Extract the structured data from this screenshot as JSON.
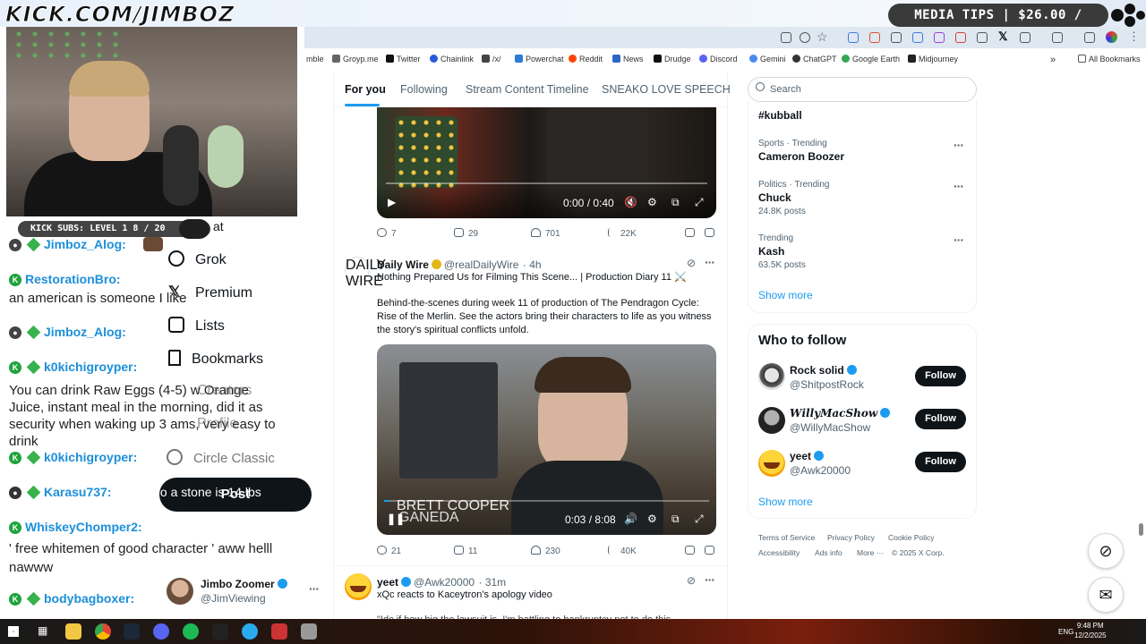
{
  "overlay": {
    "stream_url": "KICK.COM/JIMBOZ",
    "media_tips": "MEDIA TIPS | $26.00 / $200.00",
    "kick_subs": "KICK SUBS: LEVEL 1 8 / 20"
  },
  "chat": [
    {
      "user": "Jimboz_Alog:",
      "text": ""
    },
    {
      "user": "RestorationBro:",
      "text": "an american is someone I like"
    },
    {
      "user": "Jimboz_Alog:",
      "text": ""
    },
    {
      "user": "k0kichigroyper:",
      "text": "You can drink Raw Eggs (4-5) w Orange Juice, instant meal in the morning, did it as security when waking up 3 ams, very easy to drink"
    },
    {
      "user": "k0kichigroyper:",
      "text": ""
    },
    {
      "user": "Karasu737:",
      "text": "ahh, no a stone is 14 lbs"
    },
    {
      "user": "WhiskeyChomper2:",
      "text": "' free whitemen of good character ' aww helll nawww"
    },
    {
      "user": "bodybagboxer:",
      "text": ""
    }
  ],
  "bookmarks": [
    "mble",
    "Groyp.me",
    "Twitter",
    "Chainlink",
    "/x/",
    "Powerchat",
    "Reddit",
    "News",
    "Drudge",
    "Discord",
    "Gemini",
    "ChatGPT",
    "Google Earth",
    "Midjourney"
  ],
  "all_bookmarks": "All Bookmarks",
  "nav": {
    "chat_partial": "at",
    "grok": "Grok",
    "premium": "Premium",
    "lists": "Lists",
    "bookmarks": "Bookmarks",
    "more_partial": "Creators",
    "profile_partial": "Profile",
    "circle_classic": "Circle Classic",
    "post_button": "Post",
    "account_name": "Jimbo Zoomer",
    "account_handle": "@JimViewing"
  },
  "tabs": [
    "For you",
    "Following",
    "Stream Content Timeline",
    "SNEAKO LOVE SPEECH"
  ],
  "tweet1": {
    "video_time": "0:00 / 0:40",
    "replies": "7",
    "reposts": "29",
    "likes": "701",
    "views": "22K"
  },
  "tweet2": {
    "name": "Daily Wire",
    "handle": "@realDailyWire",
    "time": "· 4h",
    "avatar_text": "DAILY WIRE",
    "headline": "Nothing Prepared Us for Filming This Scene... | Production Diary 11 ⚔️",
    "body": "Behind-the-scenes during week 11 of production of The Pendragon Cycle: Rise of the Merlin. See the actors bring their characters to life as you witness the story's spiritual conflicts unfold.",
    "video_caption": "BRETT COOPER",
    "video_caption2": "GANEDA",
    "video_time": "0:03 / 8:08",
    "replies": "21",
    "reposts": "11",
    "likes": "230",
    "views": "40K"
  },
  "tweet3": {
    "name": "yeet",
    "handle": "@Awk20000",
    "time": "· 31m",
    "text": "xQc reacts to Kaceytron's apology video",
    "text2": "\"Idc if how big the lawsuit is, I'm battling to bankruptcy not to do this"
  },
  "search": {
    "placeholder": "Search"
  },
  "trends": [
    {
      "meta": "",
      "title": "#kubball",
      "posts": ""
    },
    {
      "meta": "Sports · Trending",
      "title": "Cameron Boozer",
      "posts": ""
    },
    {
      "meta": "Politics · Trending",
      "title": "Chuck",
      "posts": "24.8K posts"
    },
    {
      "meta": "Trending",
      "title": "Kash",
      "posts": "63.5K posts"
    }
  ],
  "show_more": "Show more",
  "who_to_follow": {
    "title": "Who to follow",
    "users": [
      {
        "name": "Rock solid",
        "handle": "@ShitpostRock",
        "button": "Follow"
      },
      {
        "name": "𝑾𝒊𝒍𝒍𝒚𝑴𝒂𝒄𝑺𝒉𝒐𝒘",
        "handle": "@WillyMacShow",
        "button": "Follow"
      },
      {
        "name": "yeet",
        "handle": "@Awk20000",
        "button": "Follow"
      }
    ],
    "show_more": "Show more"
  },
  "footer": [
    "Terms of Service",
    "Privacy Policy",
    "Cookie Policy",
    "Accessibility",
    "Ads info",
    "More ···",
    "© 2025 X Corp."
  ],
  "taskbar": {
    "lang": "ENG",
    "time": "9:48 PM",
    "date": "12/2/2025"
  },
  "colors": {
    "accent": "#1d9bf0",
    "kick_green": "#1fa33c",
    "chat_name": "#1c8fd9"
  }
}
